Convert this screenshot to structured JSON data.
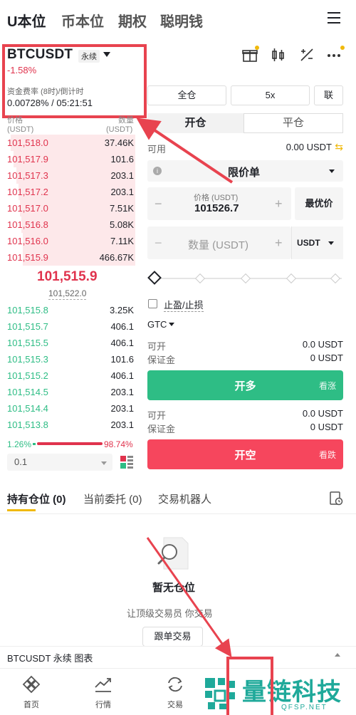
{
  "topnav": {
    "tabs": [
      "U本位",
      "币本位",
      "期权",
      "聪明钱"
    ]
  },
  "header": {
    "symbol": "BTCUSDT",
    "badge": "永续",
    "change": "-1.58%",
    "funding_label": "资金费率 (8时)/倒计时",
    "funding_value": "0.00728% / 05:21:51"
  },
  "orderbook": {
    "head_price": "价格",
    "head_qty": "数量",
    "head_price_unit": "(USDT)",
    "head_qty_unit": "(USDT)",
    "asks": [
      {
        "price": "101,518.0",
        "qty": "37.46K",
        "depth": 0.97
      },
      {
        "price": "101,517.9",
        "qty": "101.6",
        "depth": 0.95
      },
      {
        "price": "101,517.3",
        "qty": "203.1",
        "depth": 0.93
      },
      {
        "price": "101,517.2",
        "qty": "203.1",
        "depth": 0.91
      },
      {
        "price": "101,517.0",
        "qty": "7.51K",
        "depth": 0.9
      },
      {
        "price": "101,516.8",
        "qty": "5.08K",
        "depth": 0.89
      },
      {
        "price": "101,516.0",
        "qty": "7.11K",
        "depth": 0.88
      },
      {
        "price": "101,515.9",
        "qty": "466.67K",
        "depth": 0.88
      }
    ],
    "last_price": "101,515.9",
    "mark_price": "101,522.0",
    "bids": [
      {
        "price": "101,515.8",
        "qty": "3.25K"
      },
      {
        "price": "101,515.7",
        "qty": "406.1"
      },
      {
        "price": "101,515.5",
        "qty": "406.1"
      },
      {
        "price": "101,515.3",
        "qty": "101.6"
      },
      {
        "price": "101,515.2",
        "qty": "406.1"
      },
      {
        "price": "101,514.5",
        "qty": "203.1"
      },
      {
        "price": "101,514.4",
        "qty": "203.1"
      },
      {
        "price": "101,513.8",
        "qty": "203.1"
      }
    ],
    "buy_ratio": "1.26%",
    "sell_ratio": "98.74%",
    "depth_step": "0.1"
  },
  "order_form": {
    "margin_mode": "全仓",
    "leverage": "5x",
    "combo": "联",
    "tab_open": "开仓",
    "tab_close": "平仓",
    "avail_label": "可用",
    "avail_value": "0.00 USDT",
    "order_type": "限价单",
    "price_label": "价格 (USDT)",
    "price_value": "101526.7",
    "best_price": "最优价",
    "qty_placeholder": "数量 (USDT)",
    "qty_unit": "USDT",
    "tpsl_label": "止盈/止损",
    "tif": "GTC",
    "long": {
      "open_label": "可开",
      "open_value": "0.0 USDT",
      "margin_label": "保证金",
      "margin_value": "0 USDT",
      "button": "开多",
      "button_side": "看涨"
    },
    "short": {
      "open_label": "可开",
      "open_value": "0.0 USDT",
      "margin_label": "保证金",
      "margin_value": "0 USDT",
      "button": "开空",
      "button_side": "看跌"
    }
  },
  "positions": {
    "tab_holdings": "持有仓位 (0)",
    "tab_orders": "当前委托 (0)",
    "tab_bots": "交易机器人",
    "empty_title": "暂无仓位",
    "empty_sub": "让顶级交易员 你交易",
    "follow_button": "跟单交易"
  },
  "chart_bar": {
    "label": "BTCUSDT 永续  图表"
  },
  "bottomnav": {
    "items": [
      "首页",
      "行情",
      "交易"
    ]
  },
  "watermark": {
    "text": "量链科技",
    "url": "QFSP.NET"
  },
  "colors": {
    "red": "#e0334d",
    "green": "#2ebd85",
    "accent": "#f0b90b",
    "annotation": "#e8434f"
  }
}
